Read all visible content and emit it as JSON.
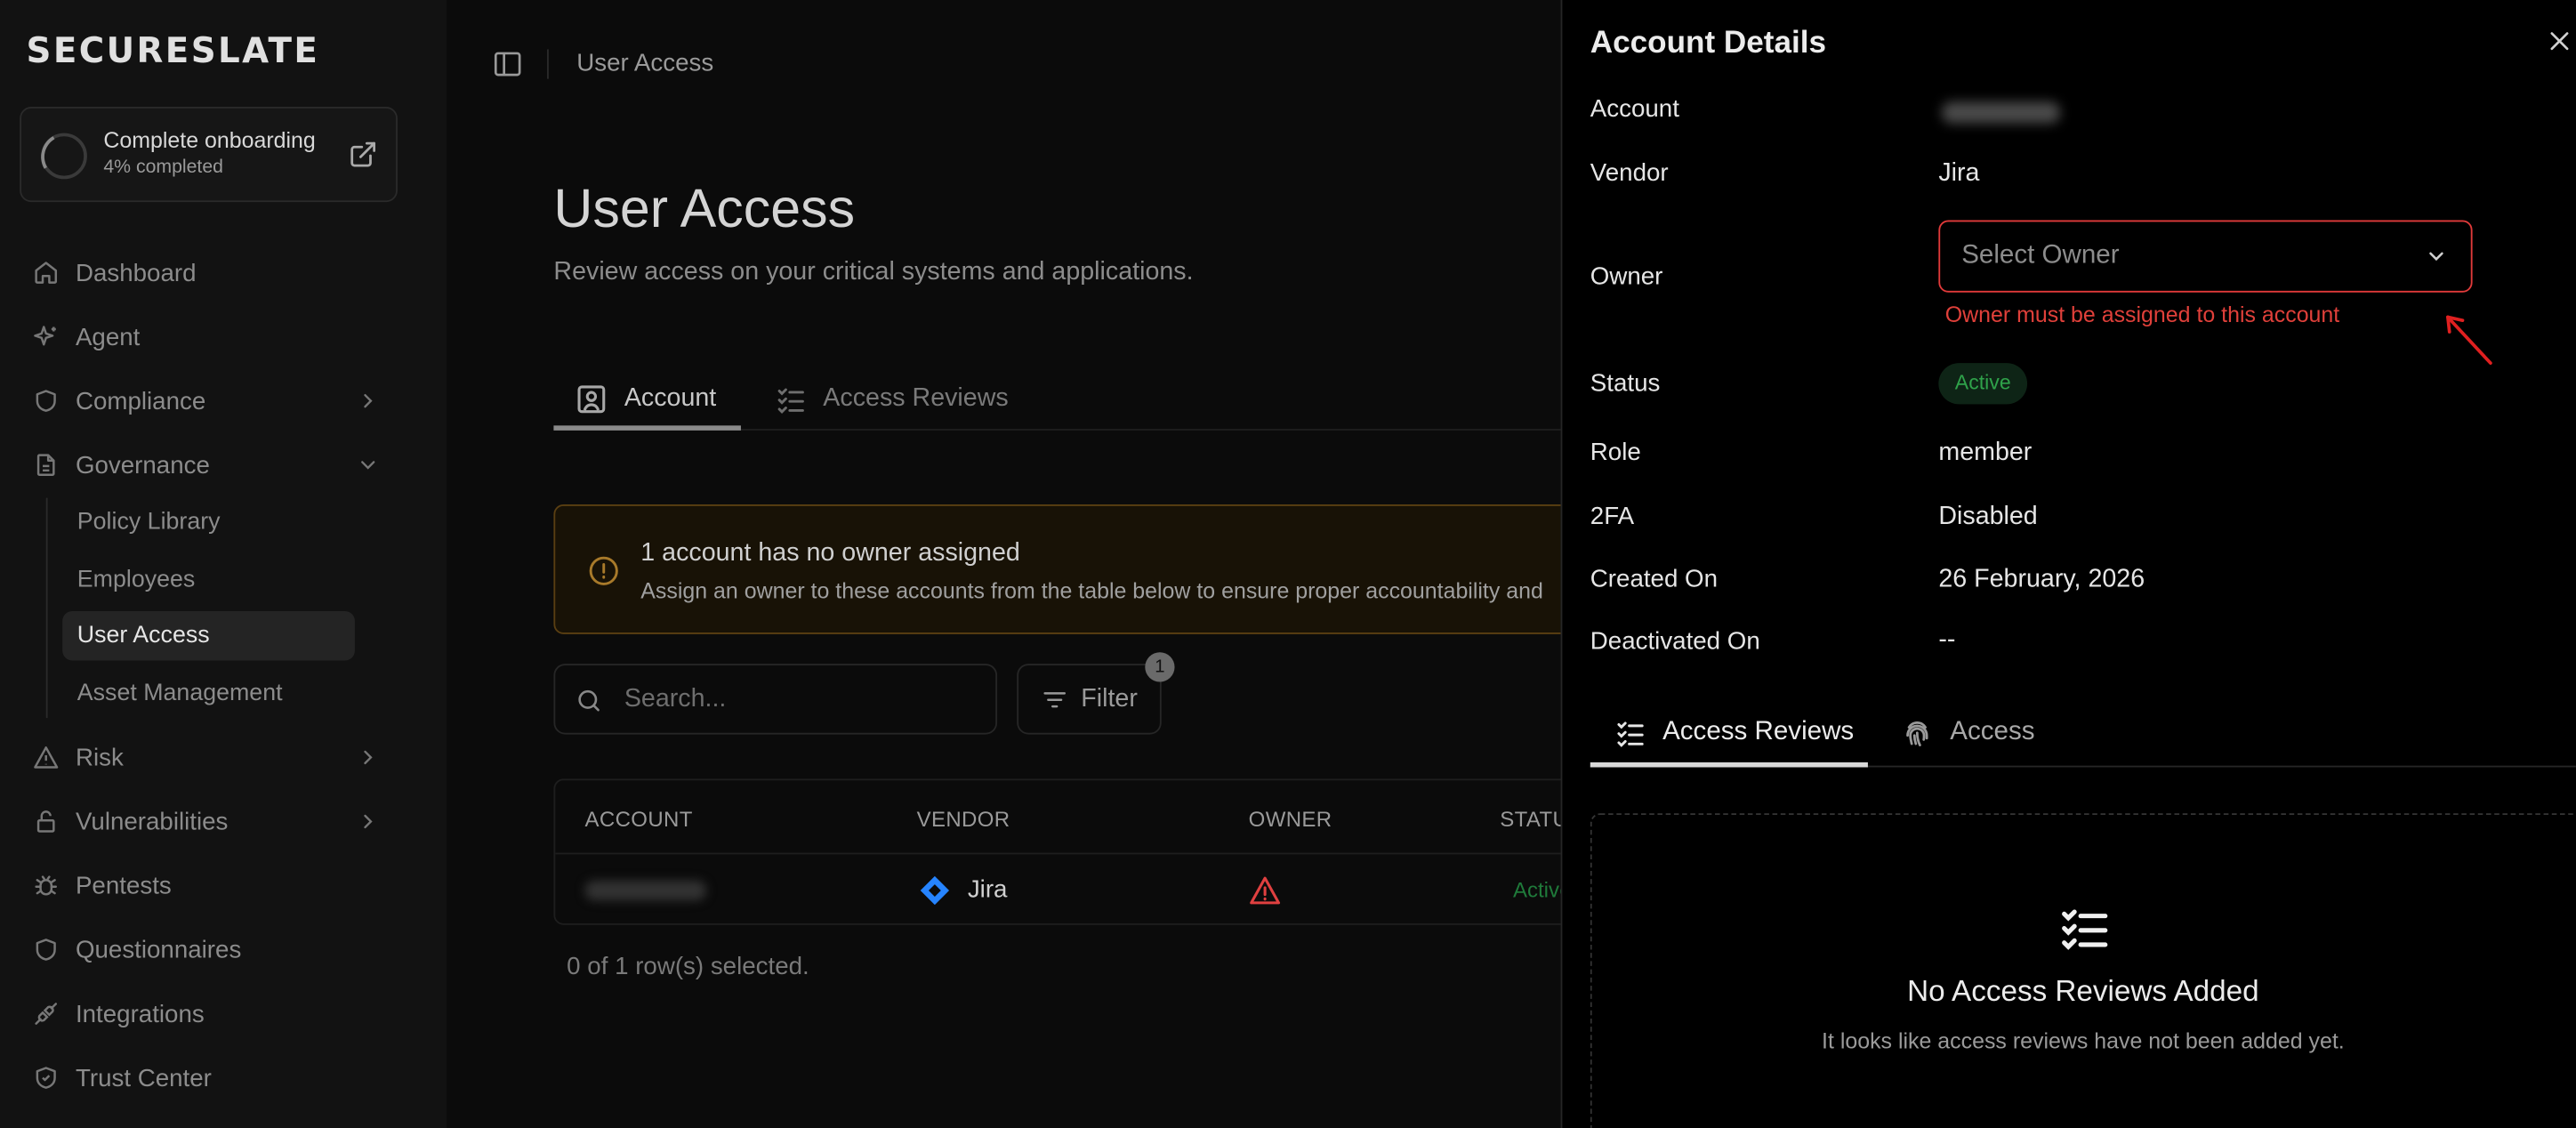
{
  "sidebar": {
    "logo": "SECURESLATE",
    "onboarding": {
      "title": "Complete onboarding",
      "progress": "4% completed",
      "progress_fraction": 0.04
    },
    "items": [
      {
        "label": "Dashboard",
        "icon": "home-icon"
      },
      {
        "label": "Agent",
        "icon": "sparkle-icon"
      },
      {
        "label": "Compliance",
        "icon": "shield-icon",
        "chevron": "right"
      },
      {
        "label": "Governance",
        "icon": "document-icon",
        "chevron": "down",
        "expanded": true
      },
      {
        "label": "Risk",
        "icon": "warning-icon",
        "chevron": "right"
      },
      {
        "label": "Vulnerabilities",
        "icon": "lock-icon",
        "chevron": "right"
      },
      {
        "label": "Pentests",
        "icon": "bug-icon"
      },
      {
        "label": "Questionnaires",
        "icon": "shield-icon"
      },
      {
        "label": "Integrations",
        "icon": "plug-icon"
      },
      {
        "label": "Trust Center",
        "icon": "shield-check-icon"
      }
    ],
    "governance_sub": [
      {
        "label": "Policy Library"
      },
      {
        "label": "Employees"
      },
      {
        "label": "User Access",
        "active": true
      },
      {
        "label": "Asset Management"
      }
    ]
  },
  "header": {
    "breadcrumb": "User Access"
  },
  "page": {
    "title": "User Access",
    "subtitle": "Review access on your critical systems and applications.",
    "tabs": [
      {
        "label": "Account",
        "active": true,
        "icon": "user-card-icon"
      },
      {
        "label": "Access Reviews",
        "active": false,
        "icon": "checklist-icon"
      }
    ],
    "warning": {
      "title": "1 account has no owner assigned",
      "body": "Assign an owner to these accounts from the table below to ensure proper accountability and"
    },
    "search": {
      "placeholder": "Search..."
    },
    "filter": {
      "label": "Filter",
      "count": "1"
    },
    "table": {
      "columns": [
        "ACCOUNT",
        "VENDOR",
        "OWNER",
        "STATUS"
      ],
      "rows": [
        {
          "account": "",
          "vendor": "Jira",
          "owner_missing": true,
          "status": "Active"
        }
      ]
    },
    "selection": "0 of 1 row(s) selected."
  },
  "panel": {
    "title": "Account Details",
    "labels": {
      "account": "Account",
      "vendor": "Vendor",
      "owner": "Owner",
      "status": "Status",
      "role": "Role",
      "twofa": "2FA",
      "created": "Created On",
      "deactivated": "Deactivated On"
    },
    "values": {
      "account": "",
      "vendor": "Jira",
      "owner_placeholder": "Select Owner",
      "owner_error": "Owner must be assigned to this account",
      "status": "Active",
      "role": "member",
      "twofa": "Disabled",
      "created": "26 February, 2026",
      "deactivated": "--"
    },
    "tabs": [
      {
        "label": "Access Reviews",
        "active": true,
        "icon": "checklist-icon"
      },
      {
        "label": "Access",
        "active": false,
        "icon": "fingerprint-icon"
      }
    ],
    "empty": {
      "title": "No Access Reviews Added",
      "subtitle": "It looks like access reviews have not been added yet."
    }
  },
  "colors": {
    "error": "#e03a3a",
    "active_status": "#2fa24a",
    "warning_border": "#5a3f12",
    "jira_blue": "#2684ff"
  }
}
